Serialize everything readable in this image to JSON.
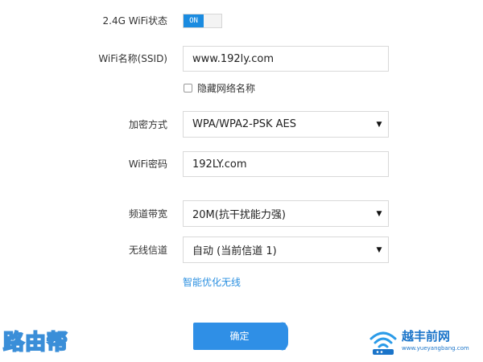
{
  "wifi_24g": {
    "status_label": "2.4G WiFi状态",
    "toggle_text": "ON",
    "ssid_label": "WiFi名称(SSID)",
    "ssid_value": "www.192ly.com",
    "hide_network_label": "隐藏网络名称",
    "hide_network_checked": false,
    "encryption_label": "加密方式",
    "encryption_value": "WPA/WPA2-PSK AES",
    "password_label": "WiFi密码",
    "password_value": "192LY.com",
    "bandwidth_label": "频道带宽",
    "bandwidth_value": "20M(抗干扰能力强)",
    "channel_label": "无线信道",
    "channel_value": "自动 (当前信道 1)",
    "optimize_link": "智能优化无线",
    "confirm_label": "确定"
  },
  "watermarks": {
    "left_text": "路由帮",
    "right_title": "越丰前网",
    "right_url": "www.yueyangbang.com"
  },
  "colors": {
    "accent": "#1a8be0",
    "button": "#2f8fe6",
    "link": "#2a8fe0"
  }
}
